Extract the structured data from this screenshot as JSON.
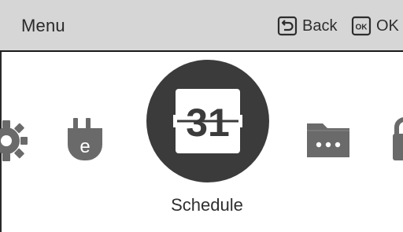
{
  "header": {
    "title": "Menu",
    "back_label": "Back",
    "ok_label": "OK",
    "ok_key_glyph": "OK"
  },
  "menu": {
    "selected_label": "Schedule",
    "calendar_day": "31",
    "energy_glyph": "e",
    "items": [
      {
        "icon": "gear-icon"
      },
      {
        "icon": "energy-plug-icon"
      },
      {
        "icon": "schedule-calendar-icon",
        "selected": true
      },
      {
        "icon": "folder-more-icon"
      },
      {
        "icon": "lock-icon"
      }
    ]
  },
  "colors": {
    "header_bg": "#d6d6d6",
    "icon": "#6a6a6a",
    "selected_circle": "#3b3b3b",
    "text": "#2a2a2a"
  }
}
